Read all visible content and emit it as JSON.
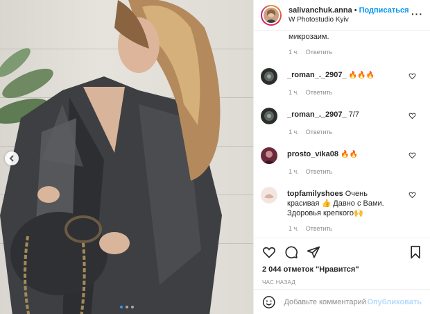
{
  "post": {
    "username": "salivanchuk.anna",
    "separator": "•",
    "follow_label": "Подписаться",
    "location": "W Photostudio Kyiv",
    "more_label": "···"
  },
  "previous_comment": {
    "text": "микрозаим.",
    "time": "1 ч.",
    "reply": "Ответить"
  },
  "comments": [
    {
      "username": "_roman_._2907_",
      "text": "🔥🔥🔥",
      "time": "1 ч.",
      "reply": "Ответить"
    },
    {
      "username": "_roman_._2907_",
      "text": "7/7",
      "time": "1 ч.",
      "reply": "Ответить"
    },
    {
      "username": "prosto_vika08",
      "text": "🔥🔥",
      "time": "1 ч.",
      "reply": "Ответить"
    },
    {
      "username": "topfamilyshoes",
      "text": "Очень красивая 👍 Давно с Вами. Здоровья крепкого🙌",
      "time": "1 ч.",
      "reply": "Ответить"
    }
  ],
  "actions": {
    "likes_text": "2 044 отметок \"Нравится\"",
    "time_ago": "ЧАС НАЗАД"
  },
  "comment_box": {
    "placeholder": "Добавьте комментарий...",
    "publish_label": "Опубликовать"
  },
  "carousel": {
    "total": 3,
    "active_index": 0
  },
  "colors": {
    "accent": "#0095f6",
    "text": "#262626",
    "muted": "#8e8e8e",
    "publish_disabled": "#b3dbff"
  }
}
